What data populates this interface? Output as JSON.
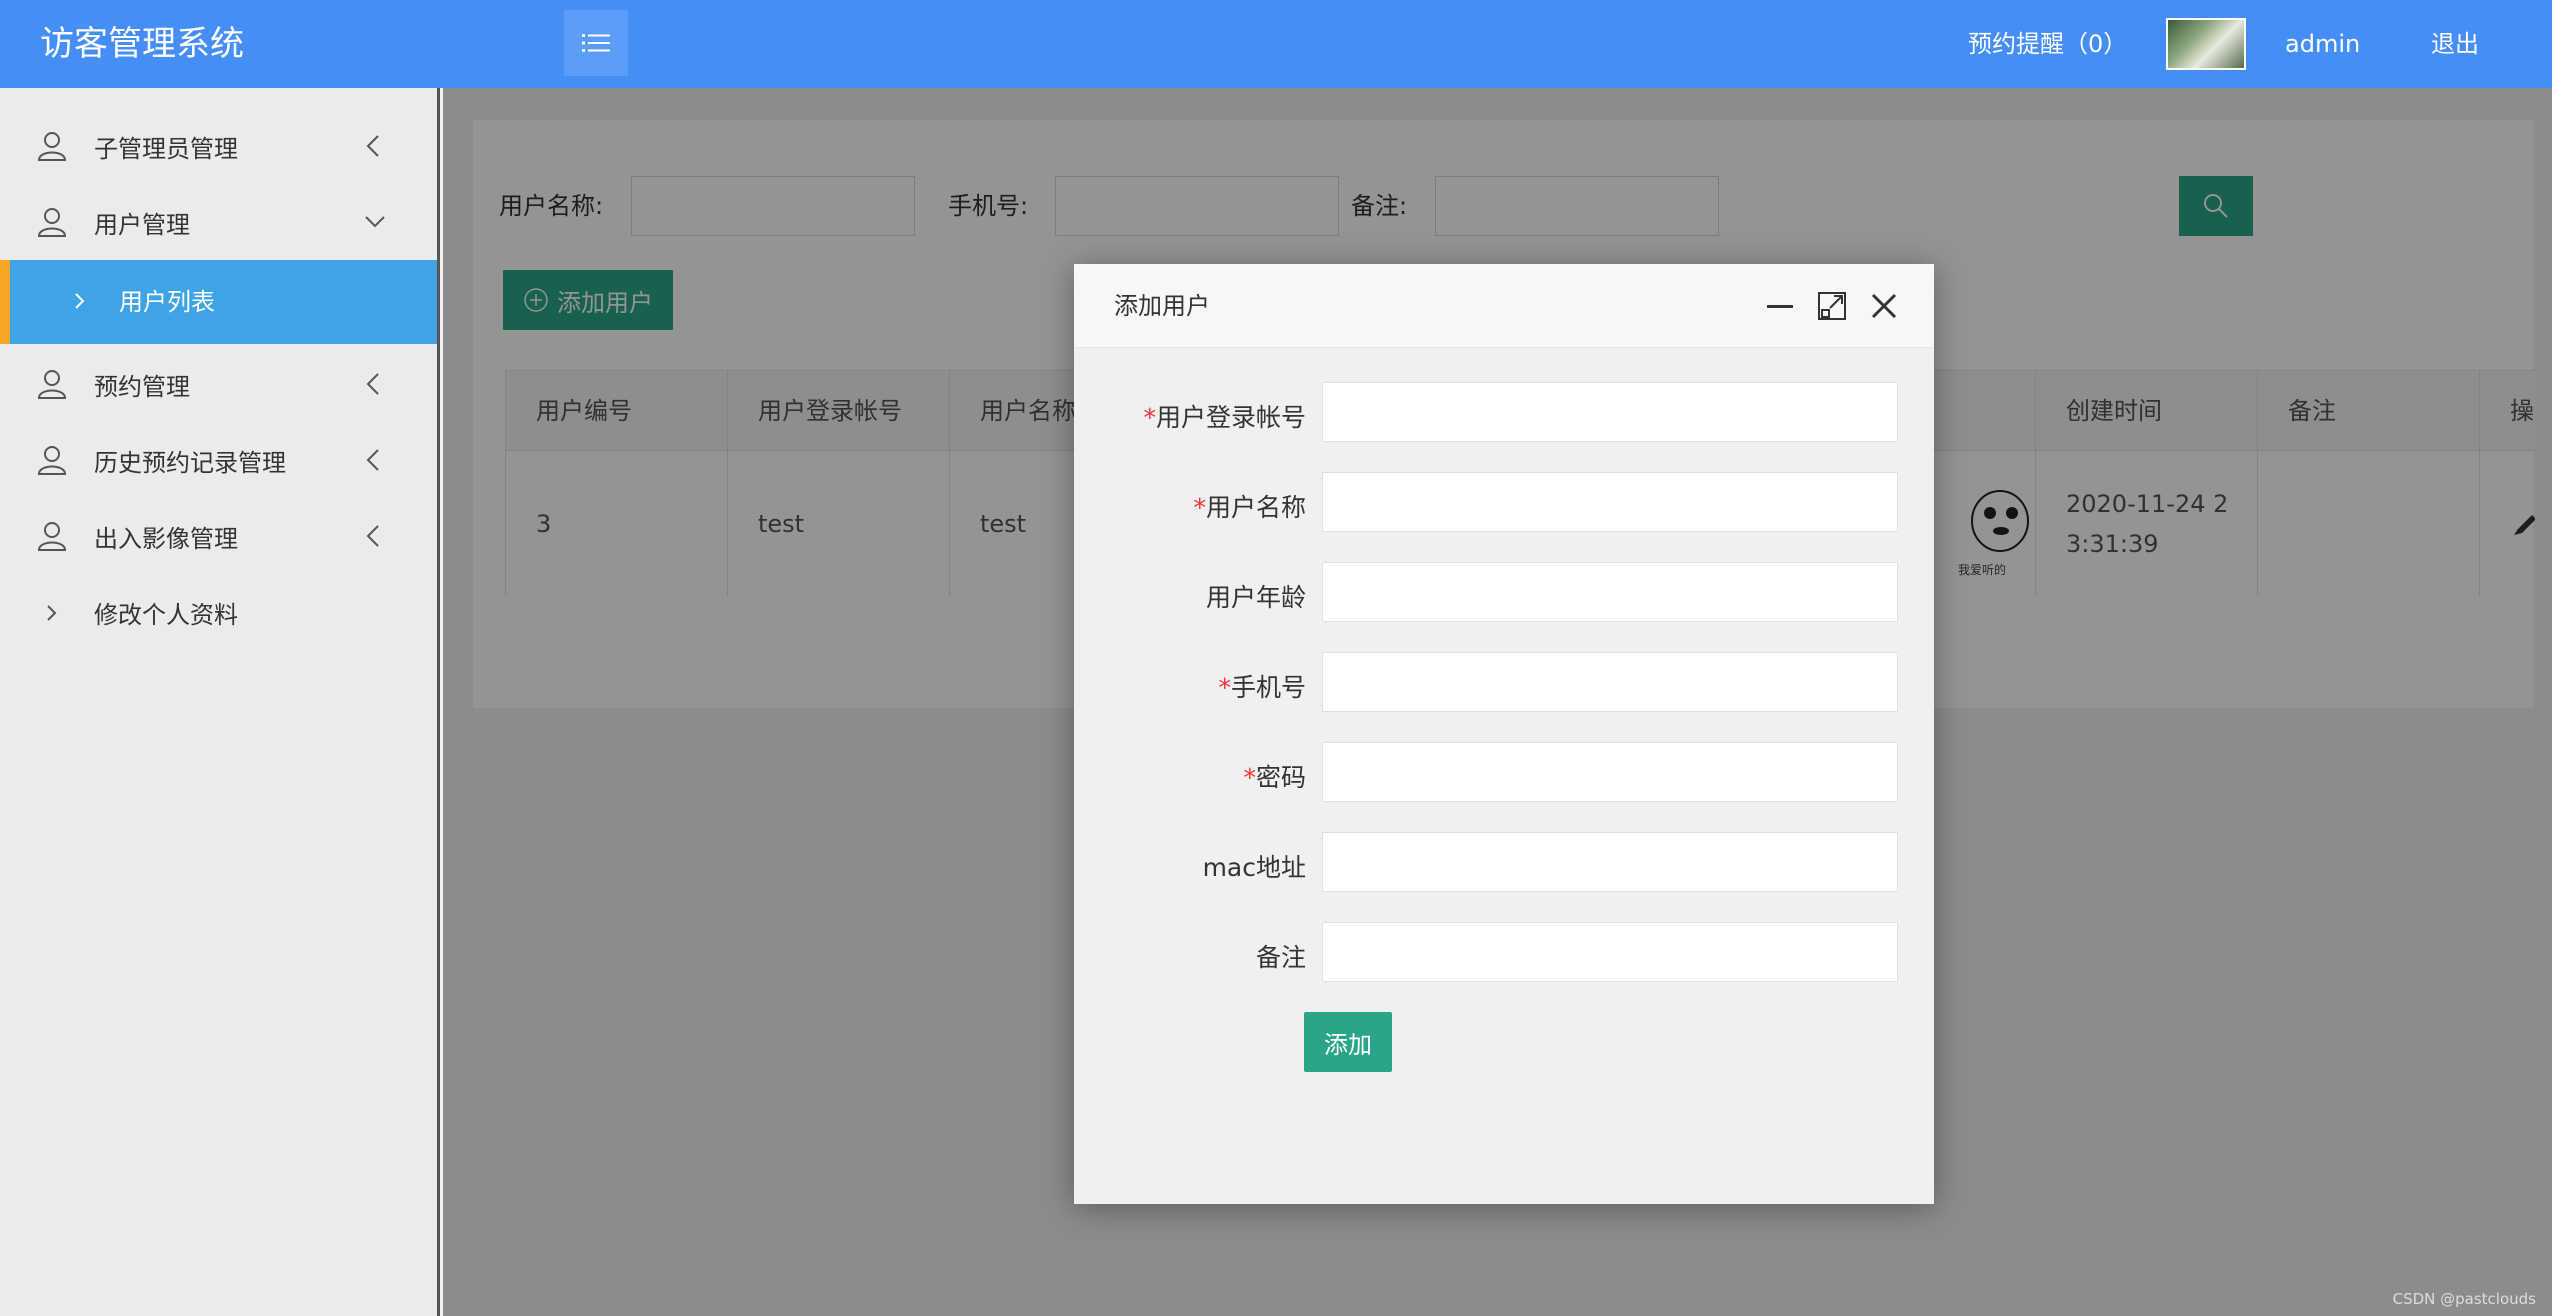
{
  "app": {
    "title": "访客管理系统"
  },
  "header": {
    "reminder": "预约提醒（0）",
    "username": "admin",
    "logout": "退出"
  },
  "sidebar": {
    "items": [
      {
        "label": "子管理员管理",
        "icon": "user-icon",
        "chevron": "chevron-left-icon"
      },
      {
        "label": "用户管理",
        "icon": "user-icon",
        "chevron": "chevron-down-icon"
      },
      {
        "label": "预约管理",
        "icon": "user-icon",
        "chevron": "chevron-left-icon"
      },
      {
        "label": "历史预约记录管理",
        "icon": "user-icon",
        "chevron": "chevron-left-icon"
      },
      {
        "label": "出入影像管理",
        "icon": "user-icon",
        "chevron": "chevron-left-icon"
      },
      {
        "label": "修改个人资料",
        "icon": "chevron-right-icon"
      }
    ],
    "sub_item": {
      "label": "用户列表",
      "active": true
    }
  },
  "search": {
    "name_label": "用户名称:",
    "phone_label": "手机号:",
    "remark_label": "备注:",
    "name_value": "",
    "phone_value": "",
    "remark_value": ""
  },
  "toolbar": {
    "add_label": "添加用户"
  },
  "table": {
    "headers": [
      "用户编号",
      "用户登录帐号",
      "用户名称",
      "创建时间",
      "备注",
      "操"
    ],
    "rows": [
      {
        "id": "3",
        "account": "test",
        "name": "test",
        "created_line1": "2020-11-24 2",
        "created_line2": "3:31:39",
        "remark": "",
        "photo_caption": "我爱听的"
      }
    ]
  },
  "modal": {
    "title": "添加用户",
    "fields": [
      {
        "label": "用户登录帐号",
        "required": true,
        "value": ""
      },
      {
        "label": "用户名称",
        "required": true,
        "value": ""
      },
      {
        "label": "用户年龄",
        "required": false,
        "value": ""
      },
      {
        "label": "手机号",
        "required": true,
        "value": ""
      },
      {
        "label": "密码",
        "required": true,
        "value": ""
      },
      {
        "label": "mac地址",
        "required": false,
        "value": ""
      },
      {
        "label": "备注",
        "required": false,
        "value": ""
      }
    ],
    "submit_label": "添加"
  },
  "watermark": "CSDN @pastclouds",
  "colors": {
    "header_bg": "#448ef6",
    "sidebar_active_bg": "#3fa4e6",
    "sidebar_active_marker": "#f5a623",
    "primary_button": "#2aa58a",
    "required_mark": "#e33333"
  }
}
